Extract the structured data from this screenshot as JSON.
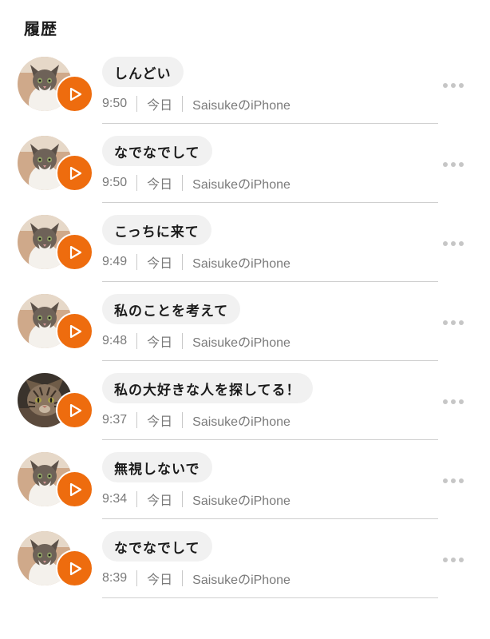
{
  "header": {
    "title": "履歴"
  },
  "colors": {
    "accent": "#ee6c0e",
    "bubble": "#f1f1f1"
  },
  "history": [
    {
      "message": "しんどい",
      "time": "9:50",
      "day": "今日",
      "device": "SaisukeのiPhone",
      "avatar": "cat-white-icon"
    },
    {
      "message": "なでなでして",
      "time": "9:50",
      "day": "今日",
      "device": "SaisukeのiPhone",
      "avatar": "cat-white-icon"
    },
    {
      "message": "こっちに来て",
      "time": "9:49",
      "day": "今日",
      "device": "SaisukeのiPhone",
      "avatar": "cat-white-icon"
    },
    {
      "message": "私のことを考えて",
      "time": "9:48",
      "day": "今日",
      "device": "SaisukeのiPhone",
      "avatar": "cat-white-icon"
    },
    {
      "message": "私の大好きな人を探してる！",
      "time": "9:37",
      "day": "今日",
      "device": "SaisukeのiPhone",
      "avatar": "cat-tabby-icon"
    },
    {
      "message": "無視しないで",
      "time": "9:34",
      "day": "今日",
      "device": "SaisukeのiPhone",
      "avatar": "cat-white-icon"
    },
    {
      "message": "なでなでして",
      "time": "8:39",
      "day": "今日",
      "device": "SaisukeのiPhone",
      "avatar": "cat-white-icon"
    }
  ]
}
